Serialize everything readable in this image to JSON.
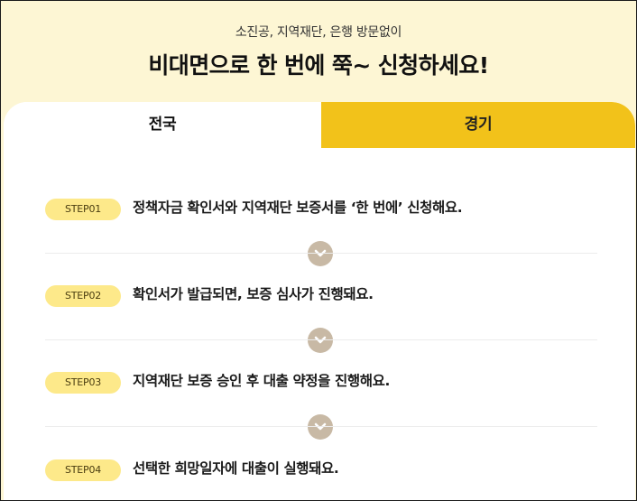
{
  "hero": {
    "subtitle": "소진공, 지역재단, 은행 방문없이",
    "title": "비대면으로 한 번에 쭉~ 신청하세요!"
  },
  "tabs": [
    {
      "label": "전국",
      "active": true
    },
    {
      "label": "경기",
      "active": false
    }
  ],
  "steps": [
    {
      "badge": "STEP01",
      "text": "정책자금 확인서와 지역재단 보증서를 ‘한 번에’ 신청해요."
    },
    {
      "badge": "STEP02",
      "text": "확인서가 발급되면, 보증 심사가 진행돼요."
    },
    {
      "badge": "STEP03",
      "text": "지역재단 보증 승인 후 대출 약정을 진행해요."
    },
    {
      "badge": "STEP04",
      "text": "선택한 희망일자에 대출이 실행돼요."
    }
  ],
  "colors": {
    "hero_bg": "#fdf6d4",
    "accent_tab": "#f2c21a",
    "badge_bg": "#fde98a",
    "chevron_circle": "#c8b9a5"
  },
  "icons": {
    "step_separator": "chevron-down-icon"
  }
}
